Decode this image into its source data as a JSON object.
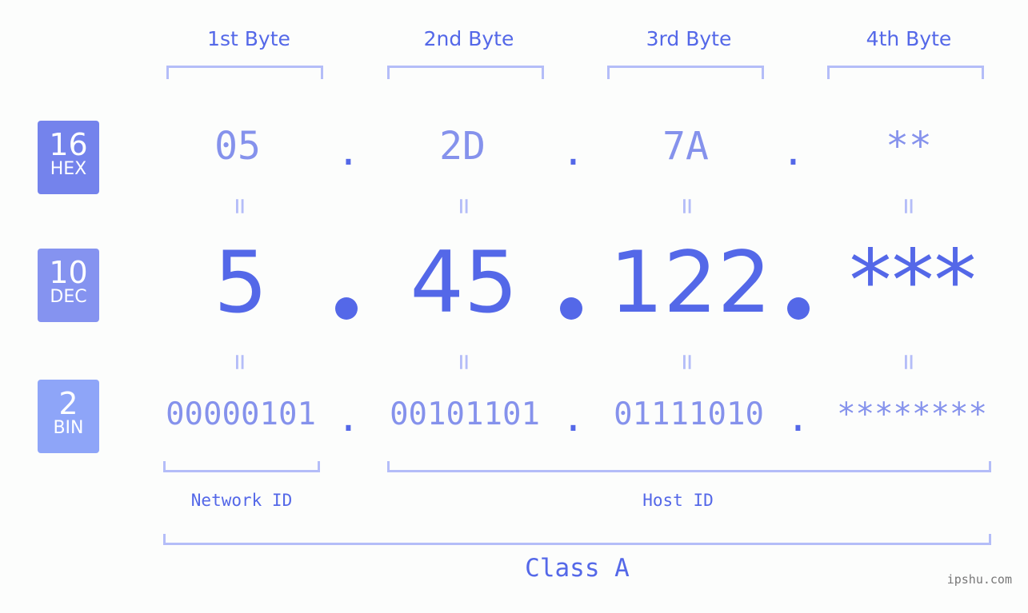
{
  "bytes": {
    "headers": [
      "1st Byte",
      "2nd Byte",
      "3rd Byte",
      "4th Byte"
    ]
  },
  "badges": {
    "hex": {
      "num": "16",
      "label": "HEX",
      "color": "#7483ec"
    },
    "dec": {
      "num": "10",
      "label": "DEC",
      "color": "#8593f0"
    },
    "bin": {
      "num": "2",
      "label": "BIN",
      "color": "#8ea5f8"
    }
  },
  "hex": [
    "05",
    "2D",
    "7A",
    "**"
  ],
  "dec": [
    "5",
    "45",
    "122",
    "***"
  ],
  "bin": [
    "00000101",
    "00101101",
    "01111010",
    "********"
  ],
  "separator": ".",
  "equals": "=",
  "segments": {
    "network_id": "Network ID",
    "host_id": "Host ID",
    "class": "Class A"
  },
  "watermark": "ipshu.com",
  "colors": {
    "accent": "#5468e8",
    "light_value": "#8592ec",
    "bracket": "#b4bdf8",
    "background": "#fcfdfc"
  }
}
